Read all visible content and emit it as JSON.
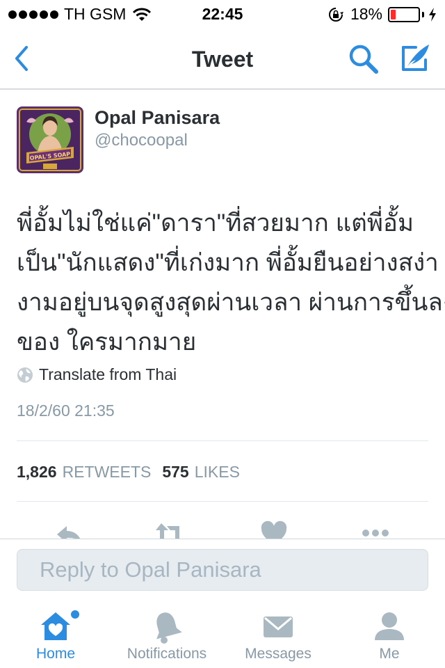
{
  "status_bar": {
    "carrier": "TH GSM",
    "time": "22:45",
    "battery_percent": "18%",
    "battery_level": 0.18,
    "battery_color": "#ff2a2a"
  },
  "nav": {
    "title": "Tweet",
    "back_icon": "chevron-left-icon",
    "search_icon": "search-icon",
    "compose_icon": "compose-quill-icon",
    "accent_color": "#2b8ce0"
  },
  "tweet": {
    "author_name": "Opal Panisara",
    "author_handle": "@chocoopal",
    "avatar_lettering": "OPAL'S SOAP",
    "text_lines": [
      "พี่อั้มไม่ใช่แค่\"ดารา\"ที่สวยมาก แต่พี่อั้ม",
      "เป็น\"นักแสดง\"ที่เก่งมาก พี่อั้มยืนอย่างสง่า",
      "งามอยู่บนจุดสูงสุดผ่านเวลา ผ่านการขึ้นลง",
      "ของ ใครมากมาย"
    ],
    "translate_label": "Translate from Thai",
    "timestamp": "18/2/60 21:35",
    "retweets_count": "1,826",
    "retweets_label": "RETWEETS",
    "likes_count": "575",
    "likes_label": "LIKES"
  },
  "actions": {
    "reply_icon": "reply-icon",
    "retweet_icon": "retweet-icon",
    "like_icon": "heart-icon",
    "more_icon": "more-dots-icon"
  },
  "reply": {
    "placeholder": "Reply to Opal Panisara"
  },
  "tabs": [
    {
      "label": "Home",
      "icon": "home-icon",
      "active": true
    },
    {
      "label": "Notifications",
      "icon": "bell-icon",
      "active": false
    },
    {
      "label": "Messages",
      "icon": "envelope-icon",
      "active": false
    },
    {
      "label": "Me",
      "icon": "person-icon",
      "active": false
    }
  ]
}
